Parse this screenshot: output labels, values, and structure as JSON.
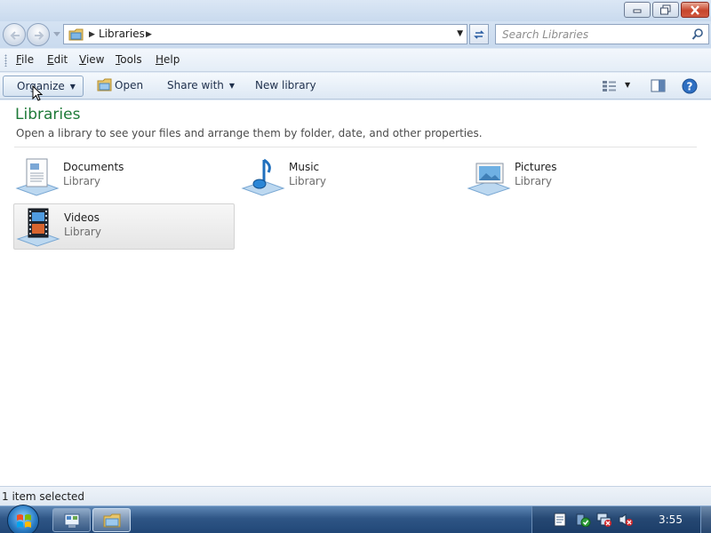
{
  "window": {
    "minimize_icon": "minimize-icon",
    "maximize_icon": "restore-icon",
    "close_icon": "close-icon"
  },
  "address": {
    "crumb": "Libraries",
    "separator": "▶"
  },
  "search": {
    "placeholder": "Search Libraries"
  },
  "menu": {
    "file": "F",
    "file_rest": "ile",
    "edit": "E",
    "edit_rest": "dit",
    "view": "V",
    "view_rest": "iew",
    "tools": "T",
    "tools_rest": "ools",
    "help": "H",
    "help_rest": "elp"
  },
  "toolbar": {
    "organize": "Organize",
    "open": "Open",
    "share_with": "Share with",
    "new_library": "New library",
    "caret": "▼"
  },
  "content": {
    "title": "Libraries",
    "description": "Open a library to see your files and arrange them by folder, date, and other properties.",
    "items": [
      {
        "name": "Documents",
        "type": "Library",
        "icon": "documents-library-icon",
        "selected": false
      },
      {
        "name": "Music",
        "type": "Library",
        "icon": "music-library-icon",
        "selected": false
      },
      {
        "name": "Pictures",
        "type": "Library",
        "icon": "pictures-library-icon",
        "selected": false
      },
      {
        "name": "Videos",
        "type": "Library",
        "icon": "videos-library-icon",
        "selected": true
      }
    ]
  },
  "status": {
    "text": "1 item selected"
  },
  "taskbar": {
    "clock": "3:55"
  },
  "colors": {
    "title_green": "#1e7a38",
    "chrome_blue": "#c9daee",
    "taskbar_blue": "#2f5686"
  }
}
